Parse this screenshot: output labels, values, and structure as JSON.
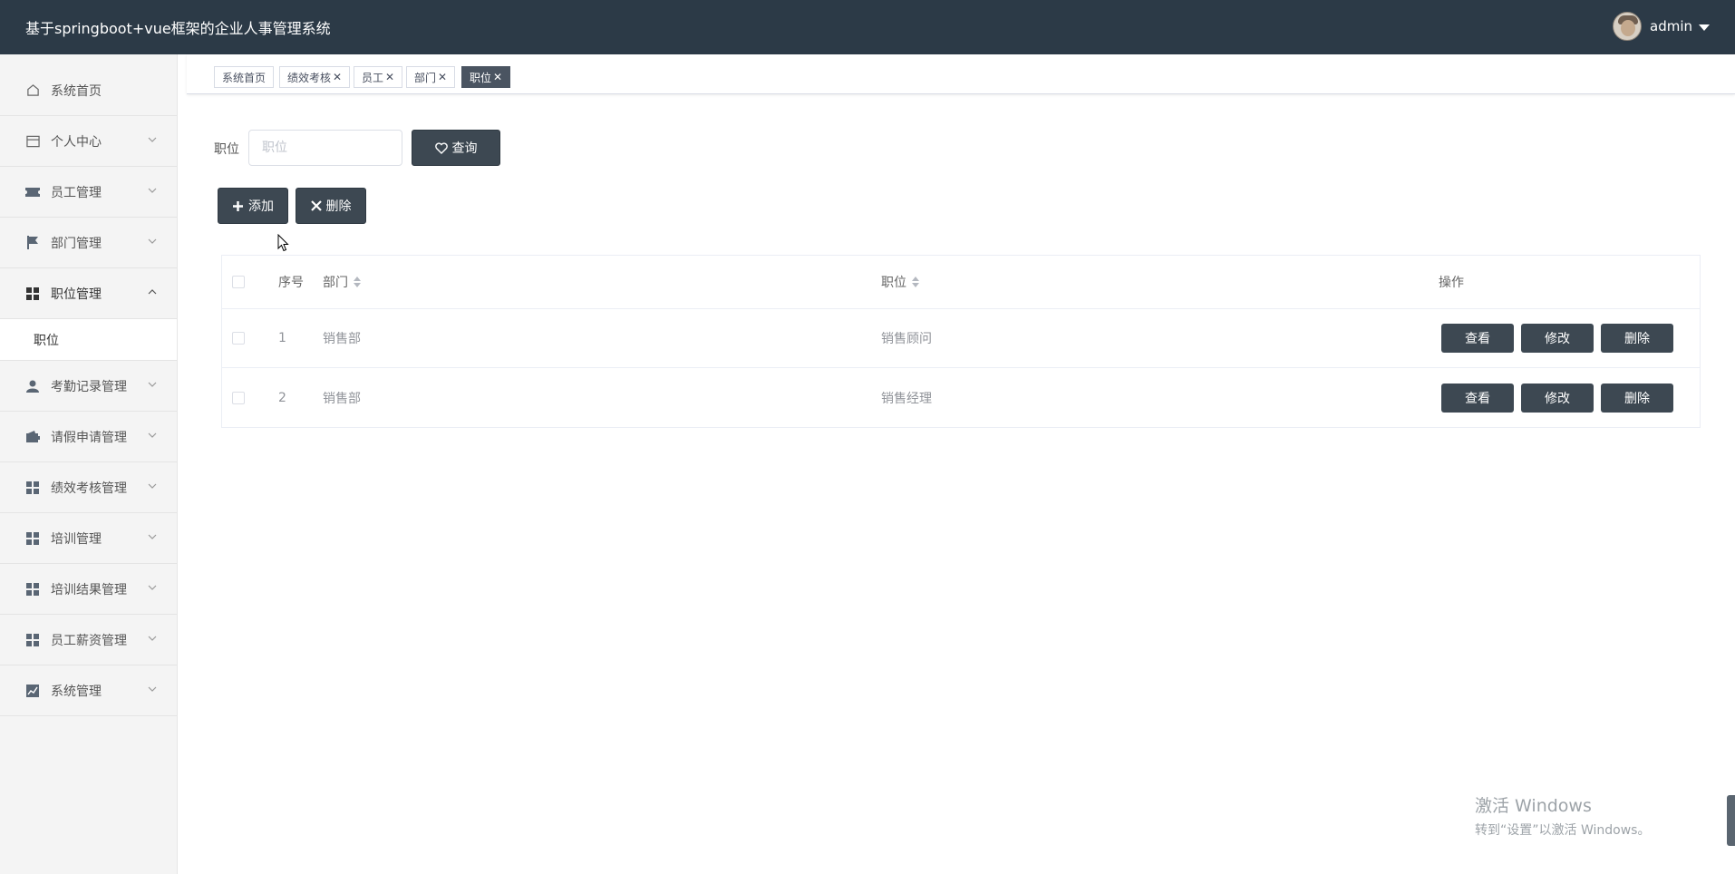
{
  "header": {
    "title": "基于springboot+vue框架的企业人事管理系统",
    "username": "admin"
  },
  "sidebar": {
    "items": [
      {
        "label": "系统首页",
        "icon": "home-icon"
      },
      {
        "label": "个人中心",
        "icon": "card-icon"
      },
      {
        "label": "员工管理",
        "icon": "ticket-icon"
      },
      {
        "label": "部门管理",
        "icon": "flag-icon"
      },
      {
        "label": "职位管理",
        "icon": "grid-icon"
      },
      {
        "label": "考勤记录管理",
        "icon": "user-icon"
      },
      {
        "label": "请假申请管理",
        "icon": "wallet-icon"
      },
      {
        "label": "绩效考核管理",
        "icon": "grid-icon"
      },
      {
        "label": "培训管理",
        "icon": "grid-icon"
      },
      {
        "label": "培训结果管理",
        "icon": "grid-icon"
      },
      {
        "label": "员工薪资管理",
        "icon": "grid-icon"
      },
      {
        "label": "系统管理",
        "icon": "chart-icon"
      }
    ],
    "active_sub": "职位"
  },
  "tags": [
    {
      "label": "系统首页",
      "closable": false
    },
    {
      "label": "绩效考核",
      "closable": true
    },
    {
      "label": "员工",
      "closable": true
    },
    {
      "label": "部门",
      "closable": true
    },
    {
      "label": "职位",
      "closable": true,
      "active": true
    }
  ],
  "search": {
    "label": "职位",
    "placeholder": "职位",
    "value": "",
    "button": "查询"
  },
  "actions": {
    "add": "添加",
    "delete": "删除"
  },
  "table": {
    "columns": {
      "index": "序号",
      "department": "部门",
      "position": "职位",
      "ops": "操作"
    },
    "rows": [
      {
        "index": "1",
        "department": "销售部",
        "position": "销售顾问"
      },
      {
        "index": "2",
        "department": "销售部",
        "position": "销售经理"
      }
    ],
    "row_buttons": {
      "view": "查看",
      "edit": "修改",
      "delete": "删除"
    }
  },
  "watermark": {
    "line1": "激活 Windows",
    "line2": "转到“设置”以激活 Windows。"
  },
  "colors": {
    "topbar": "#2c3a47",
    "button": "#3d4852",
    "sidebar": "#f4f4f4"
  }
}
